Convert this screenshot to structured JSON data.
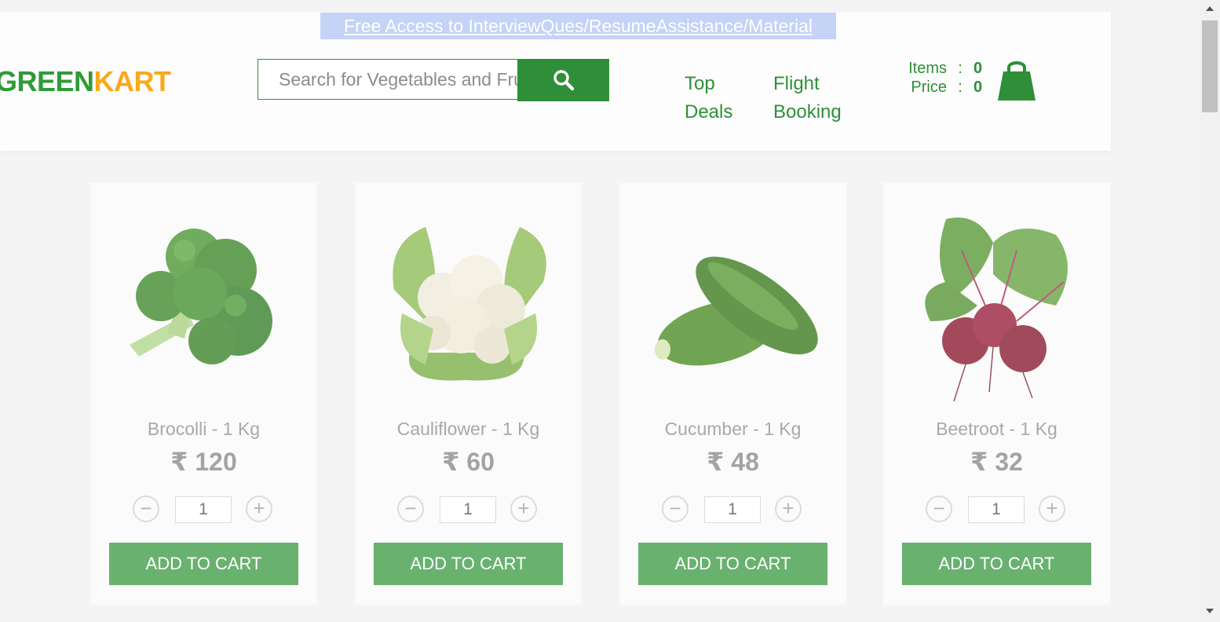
{
  "header": {
    "promo_link": "Free Access to InterviewQues/ResumeAssistance/Material",
    "brand_part1": "GREEN",
    "brand_part2": "KART",
    "search_placeholder": "Search for Vegetables and Fruits",
    "nav": [
      {
        "line1": "Top",
        "line2": "Deals"
      },
      {
        "line1": "Flight",
        "line2": "Booking"
      }
    ],
    "cart": {
      "items_label": "Items",
      "items_value": "0",
      "price_label": "Price",
      "price_value": "0",
      "separator": ":"
    }
  },
  "colors": {
    "brand_green": "#2f9b37",
    "brand_orange": "#f9a91b",
    "primary": "#2e8f38",
    "add_button": "#68b16e",
    "promo_bg": "#c4d3f6"
  },
  "products": [
    {
      "name": "Brocolli - 1 Kg",
      "price": "₹ 120",
      "quantity": "1",
      "add_label": "ADD TO CART",
      "minus": "−",
      "plus": "+",
      "image": "broccoli"
    },
    {
      "name": "Cauliflower - 1 Kg",
      "price": "₹ 60",
      "quantity": "1",
      "add_label": "ADD TO CART",
      "minus": "−",
      "plus": "+",
      "image": "cauliflower"
    },
    {
      "name": "Cucumber - 1 Kg",
      "price": "₹ 48",
      "quantity": "1",
      "add_label": "ADD TO CART",
      "minus": "−",
      "plus": "+",
      "image": "cucumber"
    },
    {
      "name": "Beetroot - 1 Kg",
      "price": "₹ 32",
      "quantity": "1",
      "add_label": "ADD TO CART",
      "minus": "−",
      "plus": "+",
      "image": "beetroot"
    }
  ]
}
